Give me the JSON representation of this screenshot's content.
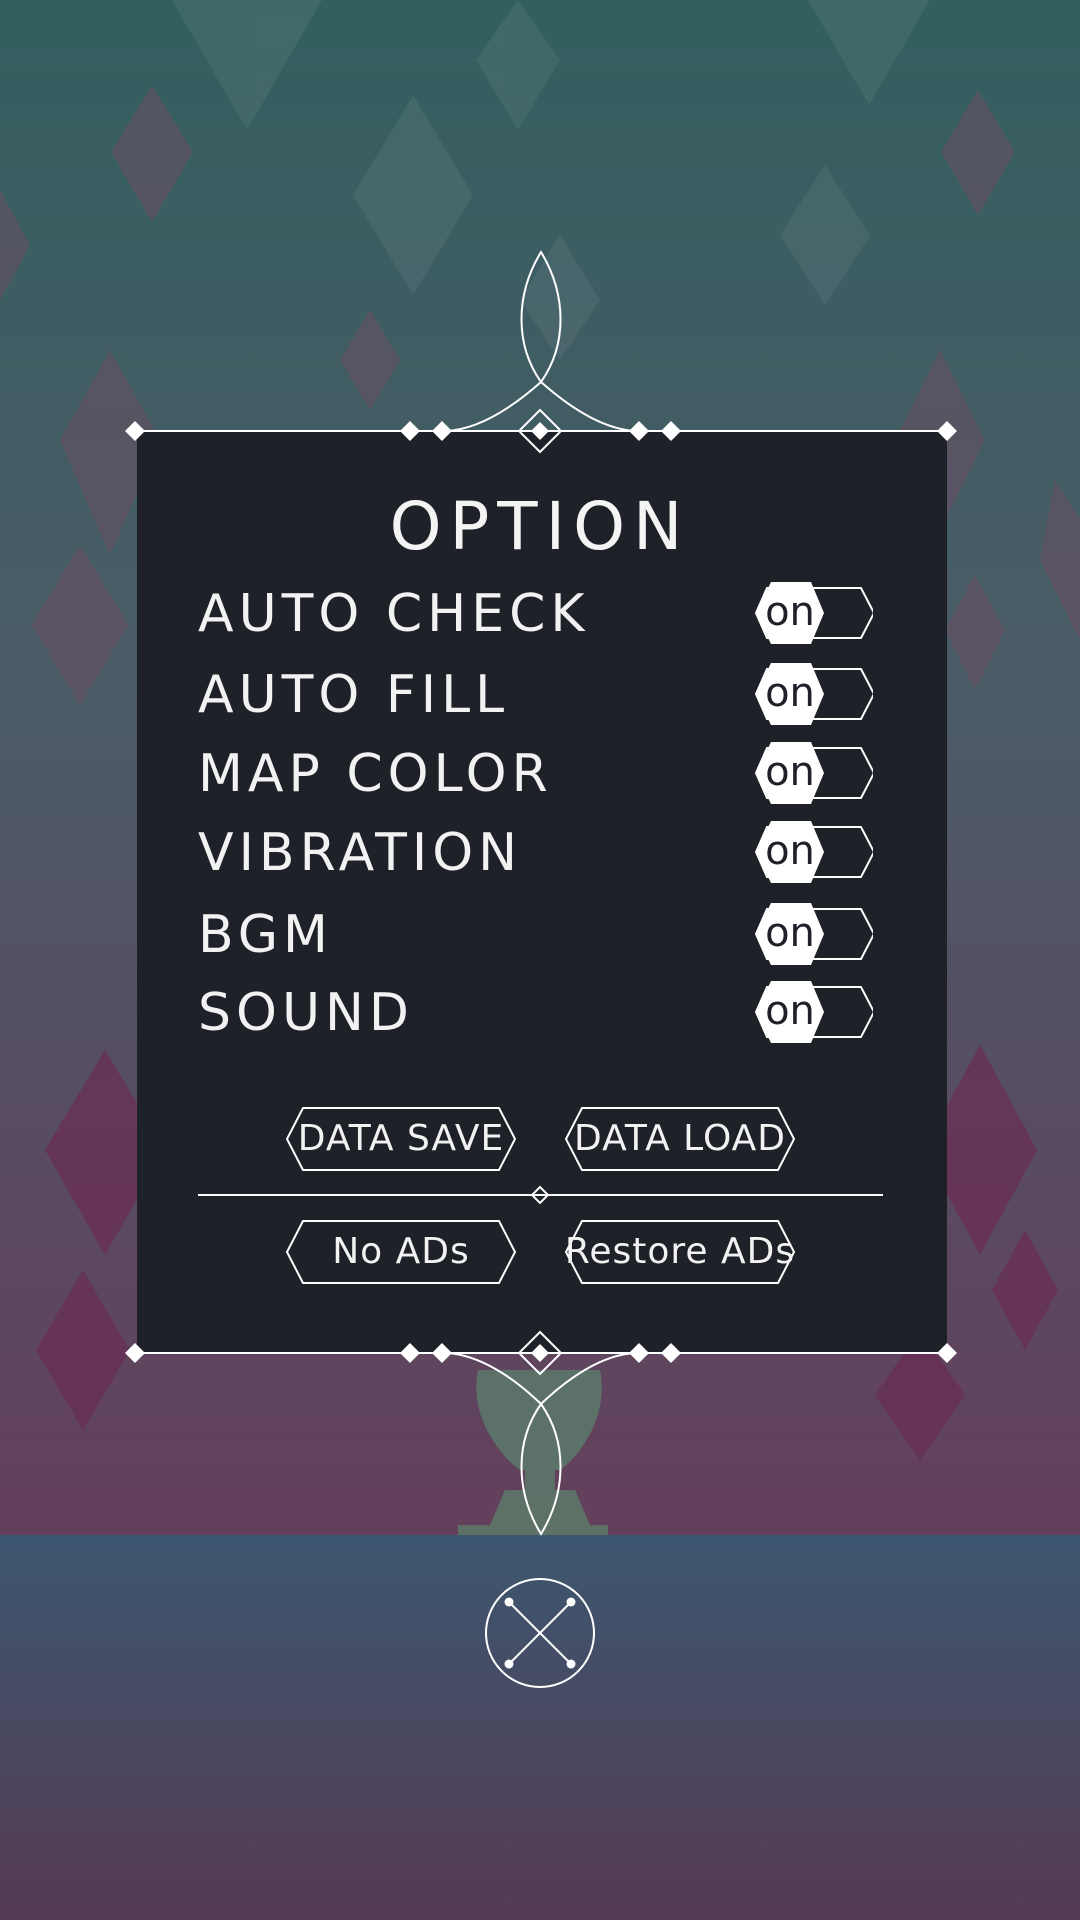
{
  "screen": {
    "title": "OPTION",
    "colors": {
      "bg_top": "#335f5f",
      "bg_mid": "#4b5b66",
      "bg_bottom": "#643f5c",
      "floor_top": "#3d5770",
      "floor_bottom": "#543a52",
      "panel": "#1e2128",
      "line": "#ffffff"
    }
  },
  "settings": [
    {
      "label": "AUTO CHECK",
      "state": "on"
    },
    {
      "label": "AUTO FILL",
      "state": "on"
    },
    {
      "label": "MAP COLOR",
      "state": "on"
    },
    {
      "label": "VIBRATION",
      "state": "on"
    },
    {
      "label": "BGM",
      "state": "on"
    },
    {
      "label": "SOUND",
      "state": "on"
    }
  ],
  "buttons": {
    "data_save": "DATA SAVE",
    "data_load": "DATA LOAD",
    "no_ads": "No ADs",
    "restore_ads": "Restore ADs"
  },
  "close_icon": "close-x-circle-icon"
}
